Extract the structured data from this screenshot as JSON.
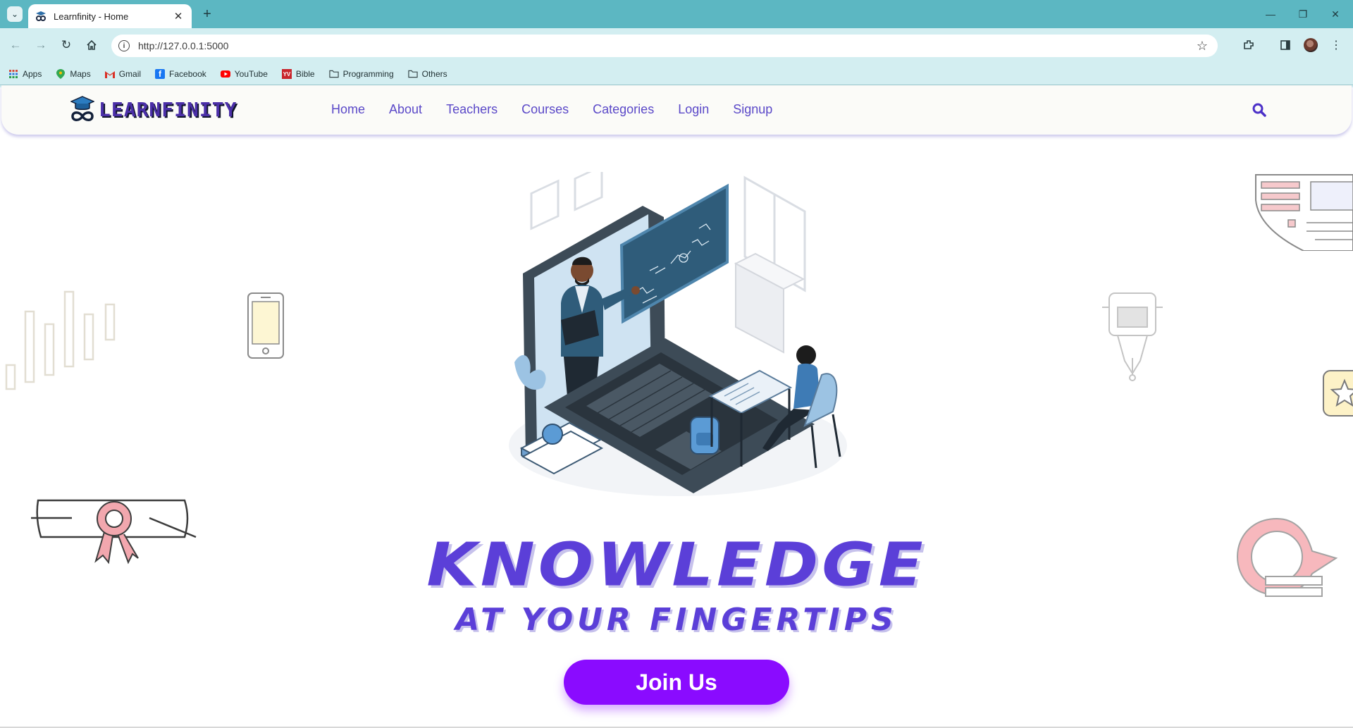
{
  "browser": {
    "tab_title": "Learnfinity - Home",
    "url": "http://127.0.0.1:5000",
    "bookmarks": [
      {
        "label": "Apps",
        "icon": "apps-grid-icon"
      },
      {
        "label": "Maps",
        "icon": "maps-pin-icon"
      },
      {
        "label": "Gmail",
        "icon": "gmail-icon"
      },
      {
        "label": "Facebook",
        "icon": "facebook-icon"
      },
      {
        "label": "YouTube",
        "icon": "youtube-icon"
      },
      {
        "label": "Bible",
        "icon": "bible-icon"
      },
      {
        "label": "Programming",
        "icon": "folder-icon"
      },
      {
        "label": "Others",
        "icon": "folder-icon"
      }
    ]
  },
  "site": {
    "logo_text": "LEARNFINITY",
    "nav": [
      "Home",
      "About",
      "Teachers",
      "Courses",
      "Categories",
      "Login",
      "Signup"
    ]
  },
  "hero": {
    "headline": "KNOWLEDGE",
    "subheadline": "AT YOUR FINGERTIPS",
    "cta": "Join Us"
  },
  "colors": {
    "chrome_tab_bar": "#5cb7c2",
    "chrome_toolbar": "#d3eef1",
    "brand_purple": "#5b3fd8",
    "nav_link": "#5a48c8",
    "cta": "#8a0bff"
  }
}
